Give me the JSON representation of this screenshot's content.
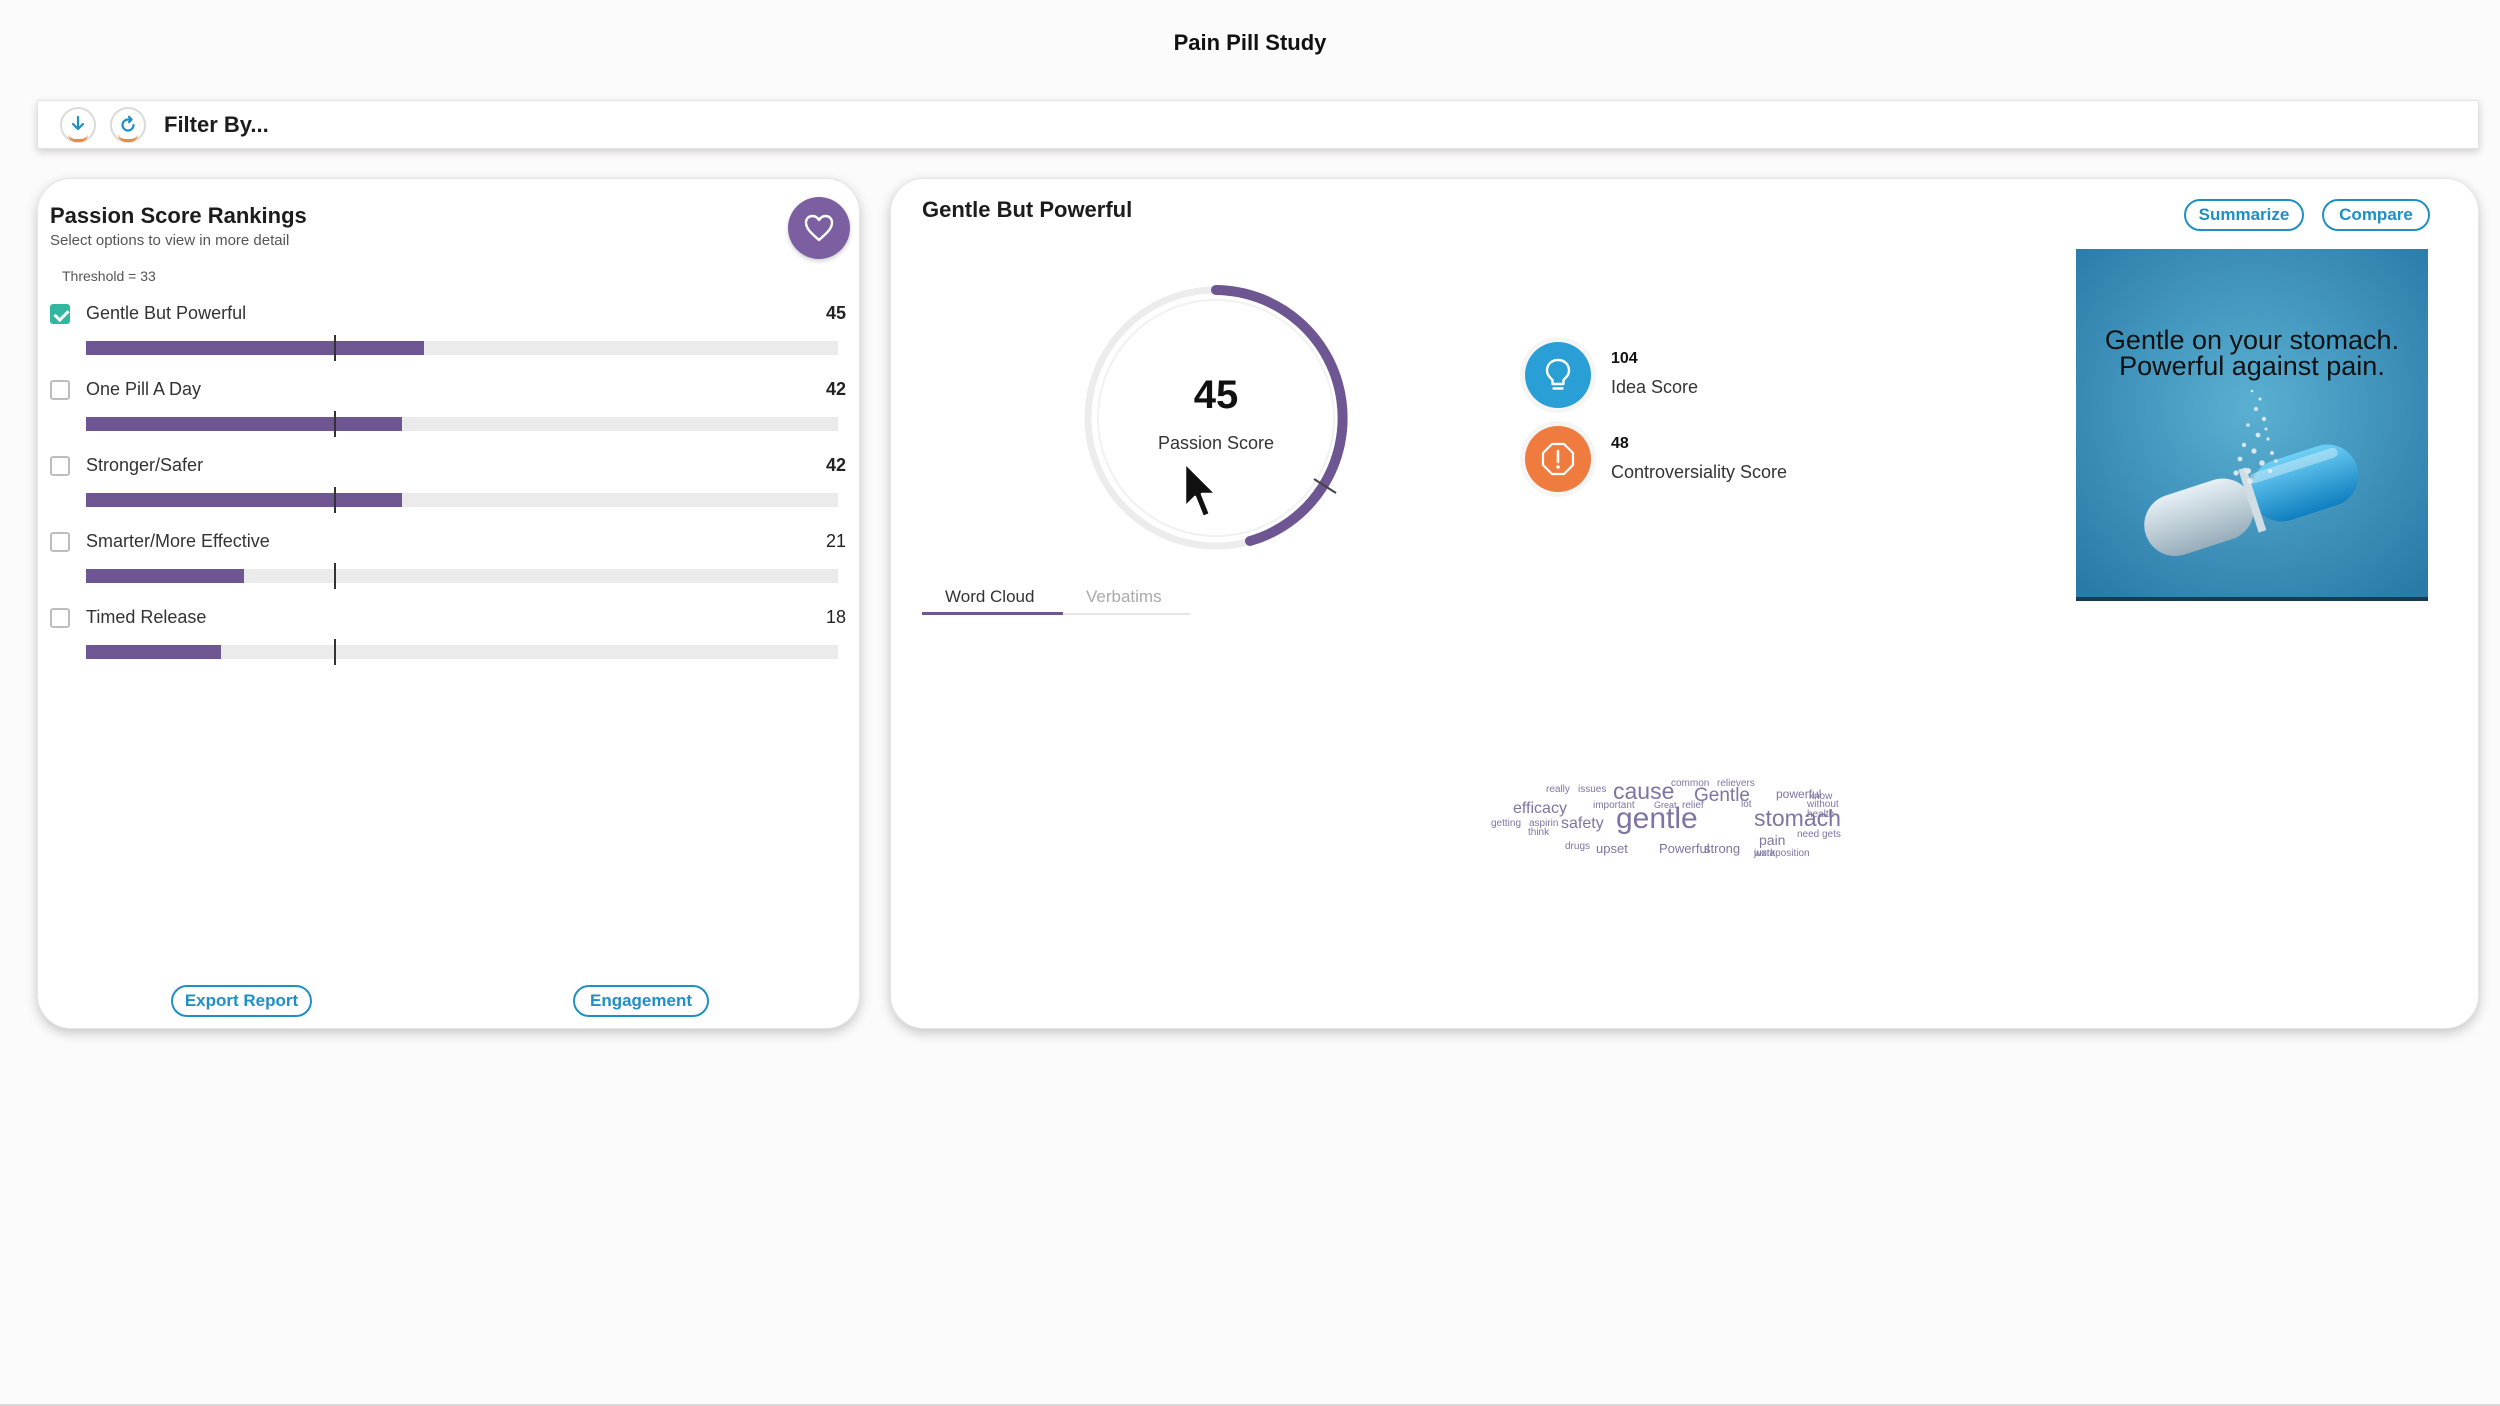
{
  "app": {
    "title": "Pain Pill Study"
  },
  "filter_bar": {
    "label": "Filter By...",
    "download_icon": "download-icon",
    "refresh_icon": "refresh-icon"
  },
  "rankings": {
    "title": "Passion Score Rankings",
    "subtitle": "Select options to view in more detail",
    "threshold_label": "Threshold = 33",
    "threshold_value": 33,
    "bar_max": 100,
    "heart_icon": "heart-icon",
    "items": [
      {
        "label": "Gentle But Powerful",
        "score": 45,
        "checked": true,
        "bold": true
      },
      {
        "label": "One Pill A Day",
        "score": 42,
        "checked": false,
        "bold": true
      },
      {
        "label": "Stronger/Safer",
        "score": 42,
        "checked": false,
        "bold": true
      },
      {
        "label": "Smarter/More Effective",
        "score": 21,
        "checked": false,
        "bold": false
      },
      {
        "label": "Timed Release",
        "score": 18,
        "checked": false,
        "bold": false
      }
    ],
    "export_label": "Export Report",
    "engagement_label": "Engagement"
  },
  "detail": {
    "title": "Gentle But Powerful",
    "summarize_label": "Summarize",
    "compare_label": "Compare",
    "passion_score": {
      "value": "45",
      "label": "Passion Score"
    },
    "idea_score": {
      "value": "104",
      "label": "Idea Score",
      "icon": "lightbulb-icon"
    },
    "controversiality_score": {
      "value": "48",
      "label": "Controversiality Score",
      "icon": "alert-icon"
    },
    "tabs": {
      "word_cloud": "Word Cloud",
      "verbatims": "Verbatims"
    },
    "image_text": {
      "line1": "Gentle on your stomach.",
      "line2": "Powerful against pain."
    },
    "word_cloud": [
      "common",
      "relievers",
      "really",
      "issues",
      "cause",
      "Gentle",
      "powerful",
      "know",
      "efficacy",
      "important",
      "Great",
      "relief",
      "lot",
      "without",
      "health",
      "getting",
      "aspirin",
      "think",
      "safety",
      "gentle",
      "stomach",
      "pain",
      "need",
      "gets",
      "drugs",
      "upset",
      "Powerful",
      "strong",
      "work",
      "juxtaposition"
    ]
  },
  "colors": {
    "accent_purple": "#6e5693",
    "link_blue": "#1f8fc5",
    "check_green": "#2fb89e",
    "idea_blue": "#2a9fd6",
    "alert_orange": "#f07b3f"
  }
}
